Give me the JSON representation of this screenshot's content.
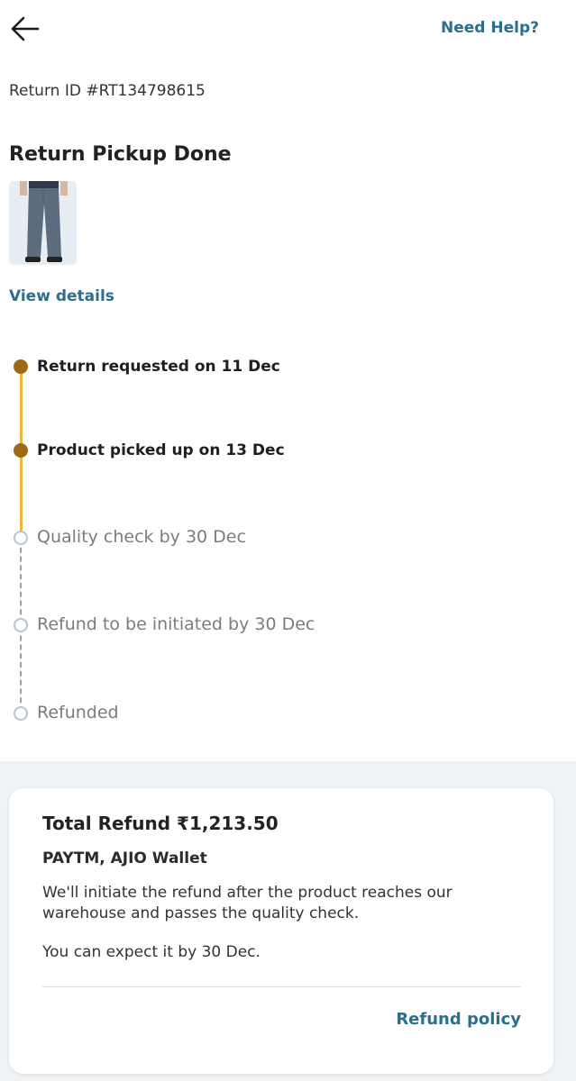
{
  "header": {
    "back_icon": "arrow-left-icon",
    "help_label": "Need Help?"
  },
  "return_id": "Return ID #RT134798615",
  "status_title": "Return Pickup Done",
  "product": {
    "image_icon": "jeans-product-thumbnail"
  },
  "view_details_label": "View details",
  "timeline": {
    "colors": {
      "done": "#9c6a12",
      "line": "#e9b93a",
      "pending": "#b8c4cf"
    },
    "steps": [
      {
        "label": "Return requested on 11 Dec",
        "done": true
      },
      {
        "label": "Product picked up on 13 Dec",
        "done": true
      },
      {
        "label": "Quality check by 30 Dec",
        "done": false
      },
      {
        "label": "Refund to be initiated by 30 Dec",
        "done": false
      },
      {
        "label": "Refunded",
        "done": false
      }
    ]
  },
  "refund": {
    "total": "Total Refund ₹1,213.50",
    "mode": "PAYTM, AJIO Wallet",
    "description": "We'll initiate the refund after the product reaches our warehouse and passes the quality check.",
    "expectation": "You can expect it by 30 Dec.",
    "policy_label": "Refund policy"
  },
  "theme": {
    "link": "#2c6e8f",
    "background_gray": "#f0f3f6"
  }
}
